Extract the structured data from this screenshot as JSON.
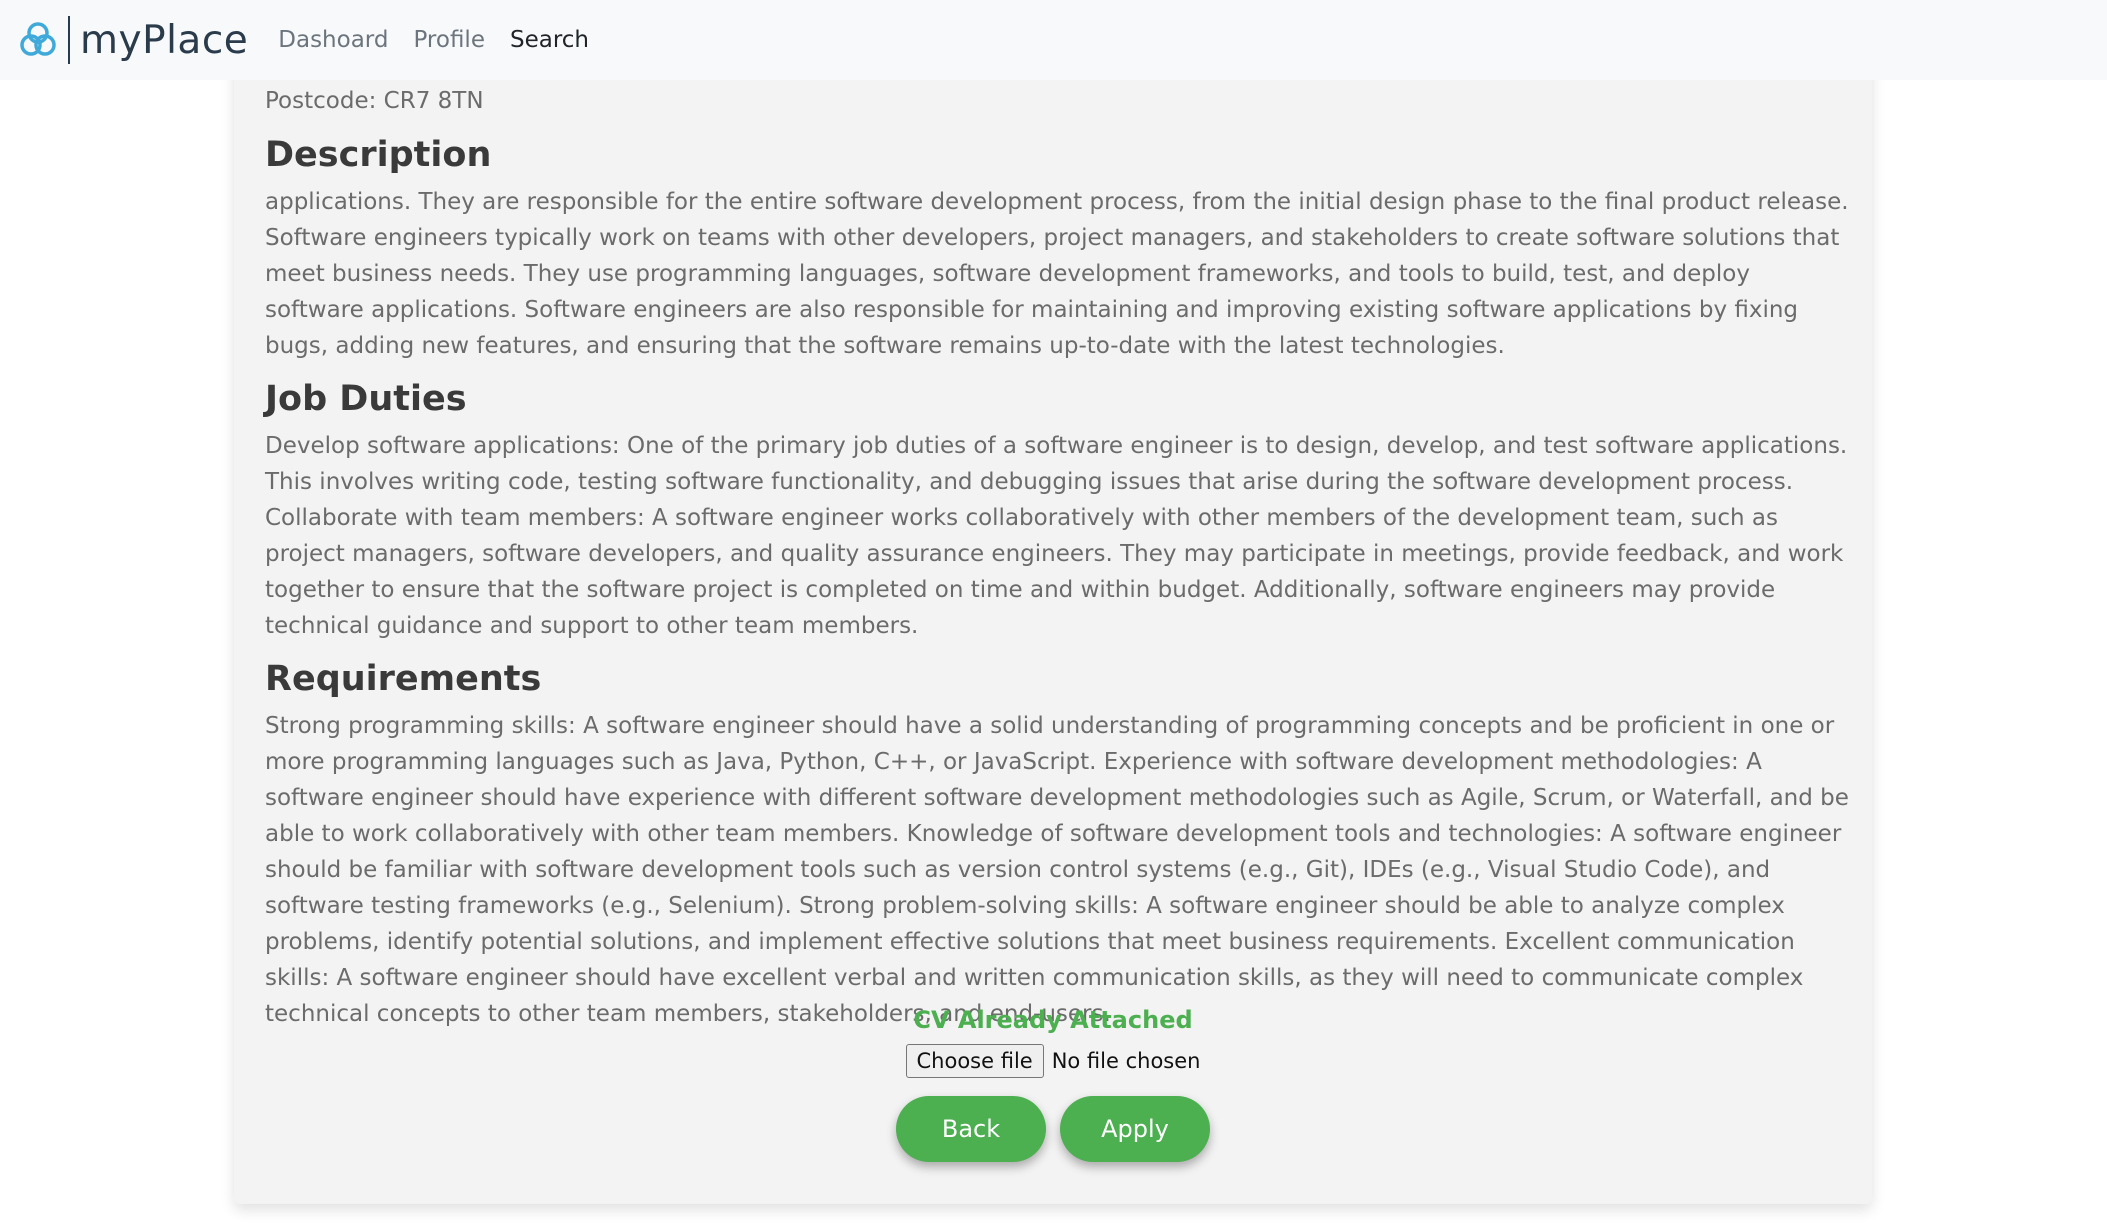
{
  "brand": {
    "name": "myPlace",
    "logo_icon": "interlocking-circles-logo-icon"
  },
  "nav": {
    "items": [
      {
        "label": "Dashoard",
        "active": false
      },
      {
        "label": "Profile",
        "active": false
      },
      {
        "label": "Search",
        "active": true
      }
    ]
  },
  "job": {
    "postcode": "Postcode: CR7 8TN",
    "description_heading": "Description",
    "description": "applications. They are responsible for the entire software development process, from the initial design phase to the final product release. Software engineers typically work on teams with other developers, project managers, and stakeholders to create software solutions that meet business needs. They use programming languages, software development frameworks, and tools to build, test, and deploy software applications. Software engineers are also responsible for maintaining and improving existing software applications by fixing bugs, adding new features, and ensuring that the software remains up-to-date with the latest technologies.",
    "duties_heading": "Job Duties",
    "duties": "Develop software applications: One of the primary job duties of a software engineer is to design, develop, and test software applications. This involves writing code, testing software functionality, and debugging issues that arise during the software development process. Collaborate with team members: A software engineer works collaboratively with other members of the development team, such as project managers, software developers, and quality assurance engineers. They may participate in meetings, provide feedback, and work together to ensure that the software project is completed on time and within budget. Additionally, software engineers may provide technical guidance and support to other team members.",
    "requirements_heading": "Requirements",
    "requirements": "Strong programming skills: A software engineer should have a solid understanding of programming concepts and be proficient in one or more programming languages such as Java, Python, C++, or JavaScript. Experience with software development methodologies: A software engineer should have experience with different software development methodologies such as Agile, Scrum, or Waterfall, and be able to work collaboratively with other team members. Knowledge of software development tools and technologies: A software engineer should be familiar with software development tools such as version control systems (e.g., Git), IDEs (e.g., Visual Studio Code), and software testing frameworks (e.g., Selenium). Strong problem-solving skills: A software engineer should be able to analyze complex problems, identify potential solutions, and implement effective solutions that meet business requirements. Excellent communication skills: A software engineer should have excellent verbal and written communication skills, as they will need to communicate complex technical concepts to other team members, stakeholders, and end-users."
  },
  "cv": {
    "status": "CV Already Attached",
    "choose_file_label": "Choose file",
    "no_file_text": "No file chosen"
  },
  "actions": {
    "back_label": "Back",
    "apply_label": "Apply"
  },
  "colors": {
    "accent_green": "#4caf50",
    "logo_blue": "#3fa9d9",
    "brand_text": "#2a3b4c"
  }
}
